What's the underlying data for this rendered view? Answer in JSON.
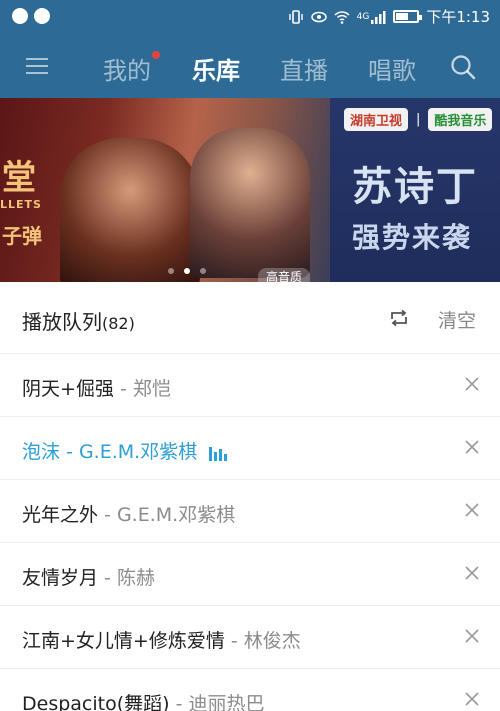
{
  "statusbar": {
    "time": "下午1:13",
    "network_label": "4G",
    "left_icons": [
      "notification-icon",
      "chat-icon"
    ],
    "right_icons": [
      "vibrate-icon",
      "eye-icon",
      "wifi-icon",
      "signal-icon",
      "battery-icon"
    ]
  },
  "nav": {
    "tabs": [
      {
        "label": "我的",
        "active": false,
        "has_dot": true
      },
      {
        "label": "乐库",
        "active": true,
        "has_dot": false
      },
      {
        "label": "直播",
        "active": false,
        "has_dot": false
      },
      {
        "label": "唱歌",
        "active": false,
        "has_dot": false
      }
    ],
    "menu_icon": "menu-icon",
    "search_icon": "search-icon",
    "colors": {
      "bar": "#2d6b96",
      "dot": "#e8403a"
    }
  },
  "banner": {
    "left_big": "堂",
    "left_small": "LLETS",
    "left_mid": "子弹",
    "right_logo_1": "湖南卫视",
    "right_logo_2": "酷我音乐",
    "right_title": "苏诗丁",
    "right_subtitle": "强势来袭",
    "tag": "高音质",
    "page_count": 3,
    "active_page": 2
  },
  "playlist": {
    "title": "播放队列",
    "count": "(82)",
    "clear_label": "清空",
    "accent": "#2c9fd6",
    "items": [
      {
        "song": "阴天+倔强",
        "artist": " - 郑恺",
        "playing": false
      },
      {
        "song": "泡沫",
        "artist": " - G.E.M.邓紫棋",
        "playing": true
      },
      {
        "song": "光年之外",
        "artist": " - G.E.M.邓紫棋",
        "playing": false
      },
      {
        "song": "友情岁月",
        "artist": " - 陈赫",
        "playing": false
      },
      {
        "song": "江南+女儿情+修炼爱情",
        "artist": " - 林俊杰",
        "playing": false
      },
      {
        "song": "Despacito(舞蹈)",
        "artist": " - 迪丽热巴",
        "playing": false
      }
    ]
  }
}
